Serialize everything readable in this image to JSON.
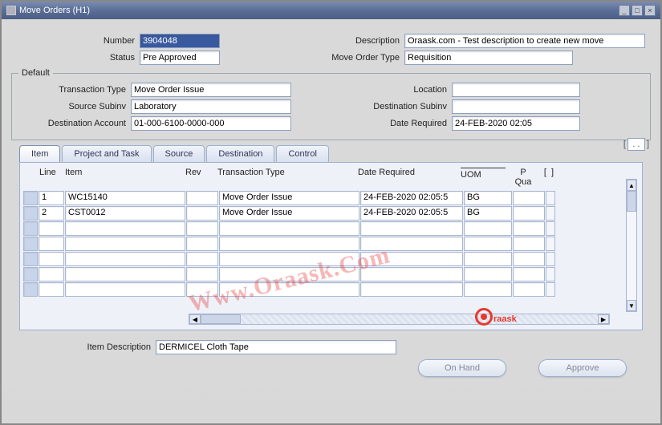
{
  "window": {
    "title": "Move Orders (H1)"
  },
  "header": {
    "number_label": "Number",
    "number_value": "3904048",
    "status_label": "Status",
    "status_value": "Pre Approved",
    "description_label": "Description",
    "description_value": "Oraask.com - Test description to create new move",
    "mot_label": "Move Order Type",
    "mot_value": "Requisition"
  },
  "default_group": {
    "legend": "Default",
    "transaction_type_label": "Transaction Type",
    "transaction_type_value": "Move Order Issue",
    "source_subinv_label": "Source Subinv",
    "source_subinv_value": "Laboratory",
    "dest_account_label": "Destination Account",
    "dest_account_value": "01-000-6100-0000-000",
    "location_label": "Location",
    "location_value": "",
    "dest_subinv_label": "Destination Subinv",
    "dest_subinv_value": "",
    "date_required_label": "Date Required",
    "date_required_value": "24-FEB-2020 02:05"
  },
  "tabs": {
    "item": "Item",
    "project": "Project and Task",
    "source": "Source",
    "destination": "Destination",
    "control": "Control"
  },
  "grid": {
    "headers": {
      "line": "Line",
      "item": "Item",
      "rev": "Rev",
      "transaction_type": "Transaction Type",
      "date_required": "Date Required",
      "uom": "UOM",
      "p": "P",
      "qua": "Qua"
    },
    "rows": [
      {
        "line": "1",
        "item": "WC15140",
        "rev": "",
        "ttype": "Move Order Issue",
        "date_req": "24-FEB-2020 02:05:5",
        "uom": "BG"
      },
      {
        "line": "2",
        "item": "CST0012",
        "rev": "",
        "ttype": "Move Order Issue",
        "date_req": "24-FEB-2020 02:05:5",
        "uom": "BG"
      }
    ]
  },
  "footer": {
    "item_desc_label": "Item Description",
    "item_desc_value": "DERMICEL Cloth Tape",
    "onhand": "On Hand",
    "approve": "Approve"
  },
  "watermark": {
    "diag": "Www.Oraask.Com",
    "flat": "raask"
  }
}
